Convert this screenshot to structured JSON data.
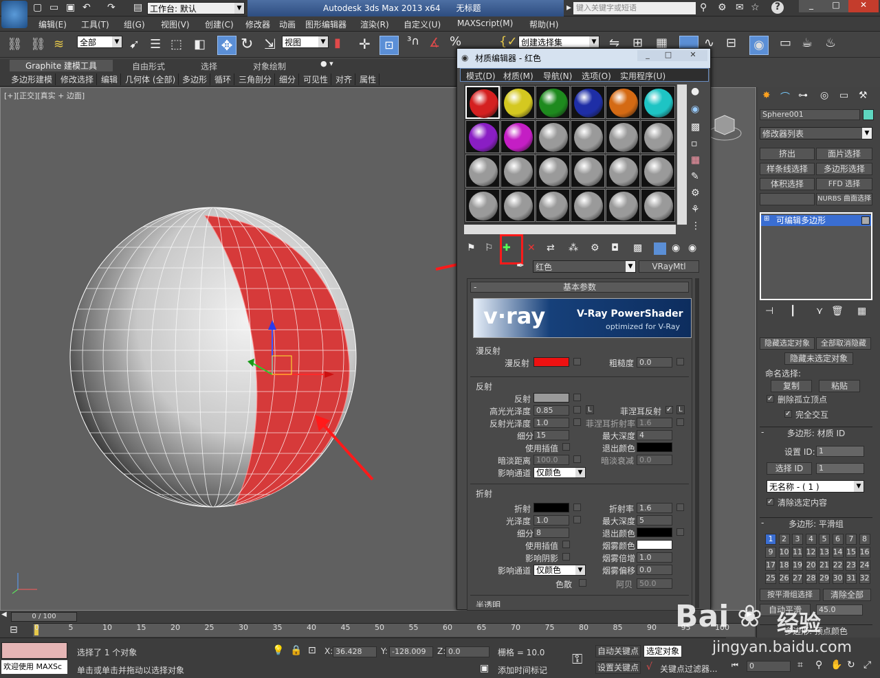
{
  "app": {
    "workspace": "工作台: 默认",
    "title": "Autodesk 3ds Max  2013 x64",
    "filename": "无标题",
    "search_placeholder": "键入关键字或短语"
  },
  "menu": [
    "编辑(E)",
    "工具(T)",
    "组(G)",
    "视图(V)",
    "创建(C)",
    "修改器",
    "动画",
    "图形编辑器",
    "渲染(R)",
    "自定义(U)",
    "MAXScript(M)",
    "帮助(H)"
  ],
  "toolbar": {
    "select_filter": "全部",
    "ref_coord": "视图",
    "selection_set": "创建选择集"
  },
  "ribbon": {
    "tabs": [
      "Graphite 建模工具",
      "自由形式",
      "选择",
      "对象绘制"
    ],
    "items": [
      "多边形建模",
      "修改选择",
      "编辑",
      "几何体 (全部)",
      "多边形",
      "循环",
      "三角剖分",
      "细分",
      "可见性",
      "对齐",
      "属性"
    ]
  },
  "viewport": {
    "label": "[+][正交][真实 + 边面]"
  },
  "material_editor": {
    "title": "材质编辑器 - 红色",
    "menu": [
      "模式(D)",
      "材质(M)",
      "导航(N)",
      "选项(O)",
      "实用程序(U)"
    ],
    "slot_colors": [
      "#d42020",
      "#d4c820",
      "#1e8a1e",
      "#1e2ea6",
      "#d46a14",
      "#1ec4c4",
      "#8a1ec4",
      "#c41ec4"
    ],
    "material_name": "红色",
    "material_type": "VRayMtl",
    "rollout_title": "基本参数",
    "vray_logo": "v·ray",
    "vray_product": "V-Ray PowerShader",
    "vray_tagline": "optimized for V-Ray",
    "diffuse": {
      "section": "漫反射",
      "label": "漫反射",
      "color": "#ee1111",
      "roughness_label": "粗糙度",
      "roughness": "0.0"
    },
    "reflection": {
      "section": "反射",
      "label": "反射",
      "color": "#9a9a9a",
      "hilight_label": "高光光泽度",
      "hilight": "0.85",
      "lock": "L",
      "fresnel_label": "菲涅耳反射",
      "fresnel_lock": "L",
      "gloss_label": "反射光泽度",
      "gloss": "1.0",
      "fresnel_ior_label": "菲涅耳折射率",
      "fresnel_ior": "1.6",
      "subdivs_label": "细分",
      "subdivs": "15",
      "max_depth_label": "最大深度",
      "max_depth": "4",
      "interp_label": "使用插值",
      "exit_color_label": "退出颜色",
      "dim_dist_label": "暗淡距离",
      "dim_dist": "100.0",
      "dim_falloff_label": "暗淡衰减",
      "dim_falloff": "0.0",
      "affect_label": "影响通道",
      "affect": "仅颜色"
    },
    "refraction": {
      "section": "折射",
      "label": "折射",
      "ior_label": "折射率",
      "ior": "1.6",
      "gloss_label": "光泽度",
      "gloss": "1.0",
      "max_depth_label": "最大深度",
      "max_depth": "5",
      "subdivs_label": "细分",
      "subdivs": "8",
      "exit_color_label": "退出颜色",
      "interp_label": "使用插值",
      "fog_color_label": "烟雾颜色",
      "shadows_label": "影响阴影",
      "fog_mult_label": "烟雾倍增",
      "fog_mult": "1.0",
      "affect_label": "影响通道",
      "affect": "仅颜色",
      "fog_bias_label": "烟雾偏移",
      "fog_bias": "0.0",
      "dispersion_label": "色散",
      "abbe_label": "阿贝",
      "abbe": "50.0"
    },
    "translucency": {
      "section": "半透明"
    }
  },
  "command_panel": {
    "object_name": "Sphere001",
    "modifier_list": "修改器列表",
    "buttons": [
      "挤出",
      "面片选择",
      "样条线选择",
      "多边形选择",
      "体积选择",
      "FFD 选择",
      "",
      "NURBS 曲面选择"
    ],
    "stack_item": "可编辑多边形",
    "hide_selected": "隐藏选定对象",
    "unhide_all": "全部取消隐藏",
    "hide_unselected": "隐藏未选定对象",
    "named_sel": "命名选择:",
    "copy": "复制",
    "paste": "粘贴",
    "delete_iso": "删除孤立顶点",
    "full_interact": "完全交互",
    "mat_id_rollout": "多边形: 材质 ID",
    "set_id": "设置 ID:",
    "set_id_val": "1",
    "select_id": "选择 ID",
    "select_id_val": "1",
    "unnamed": "无名称 - ( 1 )",
    "clear_sel": "清除选定内容",
    "smooth_rollout": "多边形: 平滑组",
    "smooth_nums": [
      "1",
      "2",
      "3",
      "4",
      "5",
      "6",
      "7",
      "8",
      "9",
      "10",
      "11",
      "12",
      "13",
      "14",
      "15",
      "16",
      "17",
      "18",
      "19",
      "20",
      "21",
      "22",
      "23",
      "24",
      "25",
      "26",
      "27",
      "28",
      "29",
      "30",
      "31",
      "32"
    ],
    "select_by_sg": "按平滑组选择",
    "clear_all": "清除全部",
    "auto_smooth": "自动平滑",
    "auto_smooth_val": "45.0",
    "vertex_color_rollout": "多边形: 顶点颜色"
  },
  "timeline": {
    "frame": "0 / 100",
    "ticks": [
      "0",
      "5",
      "10",
      "15",
      "20",
      "25",
      "30",
      "35",
      "40",
      "45",
      "50",
      "55",
      "60",
      "65",
      "70",
      "75",
      "80",
      "85",
      "90",
      "95",
      "100"
    ]
  },
  "status": {
    "welcome": "欢迎使用 MAXSc",
    "selected": "选择了 1 个对象",
    "hint": "单击或单击并拖动以选择对象",
    "x": "36.428",
    "y": "-128.009",
    "z": "0.0",
    "grid": "栅格 = 10.0",
    "add_time_tag": "添加时间标记",
    "auto_key": "自动关键点",
    "selected_obj": "选定对象",
    "set_key": "设置关键点",
    "key_filter": "关键点过滤器...",
    "frame_val": "0"
  },
  "watermark": {
    "brand": "Bai",
    "brand2": "经验",
    "site": "jingyan.baidu.com"
  }
}
